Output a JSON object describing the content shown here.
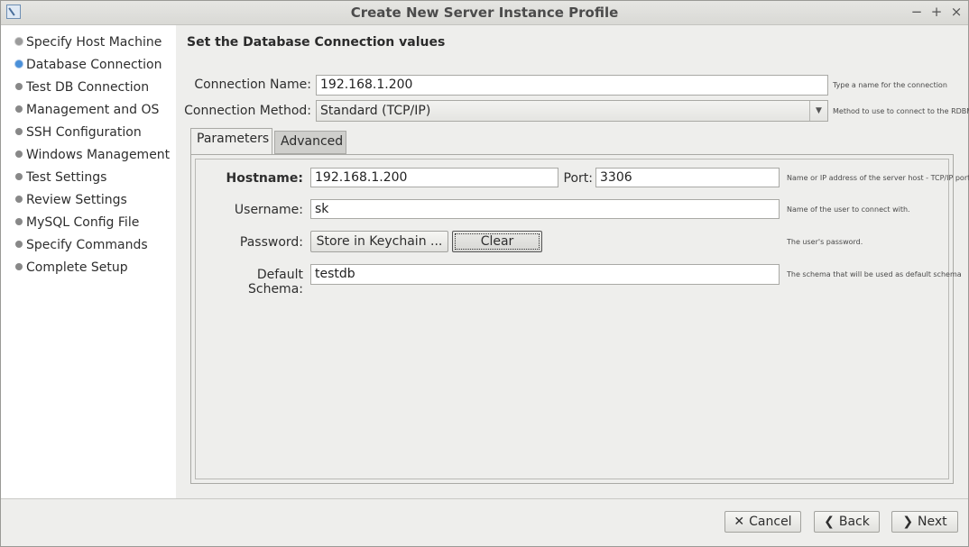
{
  "window": {
    "title": "Create New Server Instance Profile",
    "controls": {
      "minimize": "−",
      "maximize": "+",
      "close": "×"
    }
  },
  "sidebar": {
    "items": [
      {
        "label": "Specify Host Machine",
        "state": "done"
      },
      {
        "label": "Database Connection",
        "state": "active"
      },
      {
        "label": "Test DB Connection",
        "state": "pending"
      },
      {
        "label": "Management and OS",
        "state": "pending"
      },
      {
        "label": "SSH Configuration",
        "state": "pending"
      },
      {
        "label": "Windows Management",
        "state": "pending"
      },
      {
        "label": "Test Settings",
        "state": "pending"
      },
      {
        "label": "Review Settings",
        "state": "pending"
      },
      {
        "label": "MySQL Config File",
        "state": "pending"
      },
      {
        "label": "Specify Commands",
        "state": "pending"
      },
      {
        "label": "Complete Setup",
        "state": "pending"
      }
    ]
  },
  "main": {
    "heading": "Set the Database Connection values",
    "connection_name": {
      "label": "Connection Name:",
      "value": "192.168.1.200",
      "hint": "Type a name for the connection"
    },
    "connection_method": {
      "label": "Connection Method:",
      "value": "Standard (TCP/IP)",
      "hint": "Method to use to connect to the RDBMS"
    },
    "tabs": [
      {
        "label": "Parameters"
      },
      {
        "label": "Advanced"
      }
    ],
    "params": {
      "hostname": {
        "label": "Hostname:",
        "value": "192.168.1.200"
      },
      "port": {
        "label": "Port:",
        "value": "3306"
      },
      "host_hint": "Name or IP address of the server host - TCP/IP port",
      "username": {
        "label": "Username:",
        "value": "sk",
        "hint": "Name of the user to connect with."
      },
      "password": {
        "label": "Password:",
        "store_button": "Store in Keychain ...",
        "clear_button": "Clear",
        "hint": "The user's password."
      },
      "default_schema": {
        "label": "Default Schema:",
        "value": "testdb",
        "hint": "The schema that will be used as default schema"
      }
    }
  },
  "footer": {
    "cancel": "Cancel",
    "back": "Back",
    "next": "Next",
    "cancel_icon": "✕",
    "back_icon": "❮",
    "next_icon": "❯"
  },
  "colors": {
    "active_step": "#4a90d9",
    "sidebar_bg": "#ffffff",
    "window_bg": "#eeeeec"
  }
}
